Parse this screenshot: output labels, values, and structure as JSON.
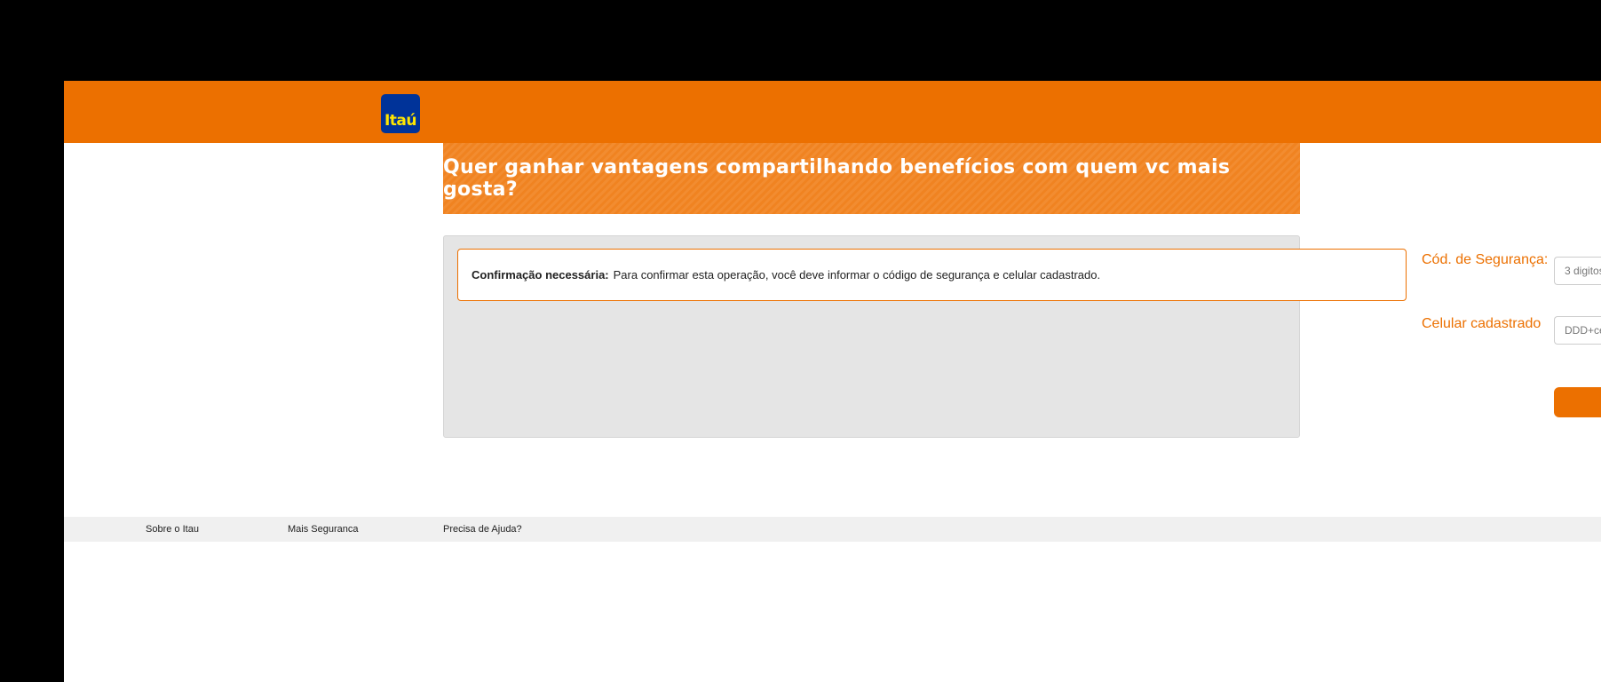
{
  "header": {
    "logo_text": "Itaú",
    "colors": {
      "brand": "#ec7000",
      "logo_bg": "#003399",
      "logo_text": "#ffe600"
    }
  },
  "banner": {
    "title": "Quer ganhar vantagens compartilhando benefícios com quem vc mais gosta?"
  },
  "notice": {
    "title": "Confirmação necessária:",
    "message": "Para confirmar esta operação, você deve informar o código de segurança e celular cadastrado."
  },
  "form": {
    "security_code": {
      "label": "Cód. de Segurança:",
      "placeholder": "3 digitos",
      "value": ""
    },
    "phone": {
      "label": "Celular cadastrado",
      "placeholder": "DDD+celular",
      "value": ""
    },
    "submit_label": ""
  },
  "footer": {
    "links": [
      "Sobre o Itau",
      "Mais Seguranca",
      "Precisa de Ajuda?"
    ]
  }
}
